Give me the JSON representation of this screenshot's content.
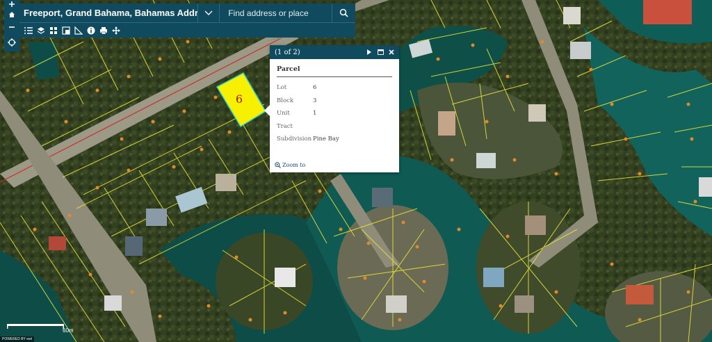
{
  "app": {
    "title": "Freeport, Grand Bahama, Bahamas Addresses"
  },
  "search": {
    "placeholder": "Find address or place"
  },
  "map": {
    "parcel_label": "6",
    "scale_label": "60m"
  },
  "popup": {
    "count": "(1 of 2)",
    "title": "Parcel",
    "fields": [
      {
        "name": "Lot",
        "value": "6"
      },
      {
        "name": "Block",
        "value": "3"
      },
      {
        "name": "Unit",
        "value": "1"
      },
      {
        "name": "Tract",
        "value": ""
      },
      {
        "name": "Subdivision",
        "value": "Pine Bay"
      }
    ],
    "zoom_label": "Zoom to"
  },
  "attribution": {
    "powered": "POWERED BY esri"
  },
  "colors": {
    "header_bg": "#0f4a5e",
    "parcel_highlight": "#f7f000",
    "parcel_lines": "#e6e23a"
  }
}
